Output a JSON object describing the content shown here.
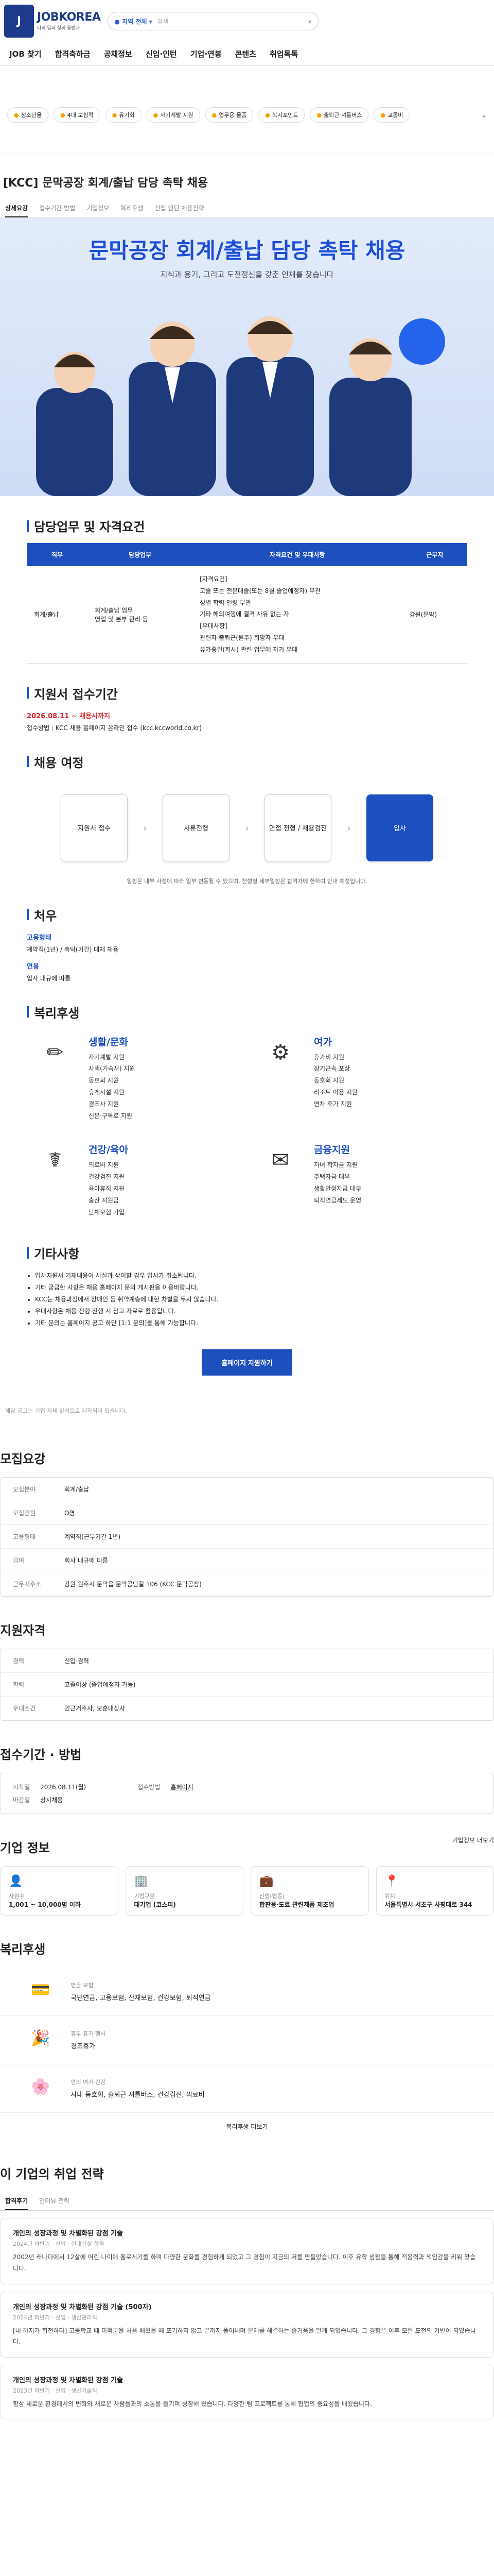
{
  "header": {
    "logo": "JOBKOREA",
    "logo_sub": "나의 일과 삶의 동반자",
    "location": "지역 전체",
    "search_placeholder": "검색"
  },
  "gnb": [
    "JOB 찾기",
    "합격축하금",
    "공채정보",
    "신입·인턴",
    "기업·연봉",
    "콘텐츠",
    "취업톡톡"
  ],
  "quick": [
    "청소년을",
    "4대 보험적",
    "유기회",
    "자기계발 지원",
    "업무용 물품",
    "복지포인트",
    "출퇴근 셔틀버스",
    "교통비"
  ],
  "job": {
    "title": "[KCC] 문막공장 회계/출납 담당 촉탁 채용"
  },
  "tabs": [
    "상세요강",
    "접수기간·방법",
    "기업정보",
    "복리후생",
    "신입 인턴 채용전략"
  ],
  "banner": {
    "title": "문막공장 회계/출납 담당 촉탁 채용",
    "sub": "지식과 용기, 그리고 도전정신을 갖춘 인재를 찾습니다"
  },
  "duty": {
    "title": "담당업무 및 자격요건",
    "headers": [
      "직무",
      "담당업무",
      "자격요건 및 우대사항",
      "근무지"
    ],
    "job": "회계/출납",
    "task": "회계/출납 업무\n영업 및 본부 관리 등",
    "req": "[자격요건]\n고졸 또는 전문대졸(또는 8월 졸업예정자) 무관\n성별 학력 연령 무관\n기타 해외여행에 결격 사유 없는 자\n[우대사항]\n관련자 출퇴근(원주) 희망자 우대\n유가증권(회사) 관련 업무에 자가 우대",
    "place": "강원(문막)"
  },
  "period": {
    "title": "지원서 접수기간",
    "date": "2026.08.11 ~ 채용시까지",
    "note": "접수방법 : KCC 채용 홈페이지 온라인 접수 (kcc.kccworld.co.kr)"
  },
  "steps": {
    "title": "채용 여정",
    "items": [
      "지원서 접수",
      "서류전형",
      "면접 전형 / 채용검진",
      "입사"
    ],
    "note": "일정은 내부 사정에 따라 일부 변동될 수 있으며, 전형별 세부일정은 합격자에 한하여 안내 예정입니다."
  },
  "treat": {
    "title": "처우",
    "label1": "고용형태",
    "val1": "계약직(1년) / 촉탁(기간) 대체 채용",
    "label2": "연봉",
    "val2": "입사 내규에 따름"
  },
  "benefits": {
    "title": "복리후생",
    "items": [
      {
        "name": "생활/문화",
        "icon": "✏",
        "list": [
          "자기계발 지원",
          "사택(기숙사) 지원",
          "동호회 지원",
          "휴게시설 지원",
          "경조사 지원",
          "신문·구독료 지원"
        ]
      },
      {
        "name": "여가",
        "icon": "⚙",
        "list": [
          "휴가비 지원",
          "장기근속 포상",
          "동호회 지원",
          "리조트 이용 지원",
          "연차 휴가 지원"
        ]
      },
      {
        "name": "건강/육아",
        "icon": "☤",
        "list": [
          "의료비 지원",
          "건강검진 지원",
          "육아휴직 지원",
          "출산 지원금",
          "단체보험 가입"
        ]
      },
      {
        "name": "금융지원",
        "icon": "✉",
        "list": [
          "자녀 학자금 지원",
          "주택자금 대부",
          "생활안정자금 대부",
          "퇴직연금제도 운영"
        ]
      }
    ]
  },
  "etc": {
    "title": "기타사항",
    "lines": [
      "입사지원서 기재내용이 사실과 상이할 경우 입사가 취소됩니다.",
      "기타 궁금한 사항은 채용 홈페이지 문의 게시판을 이용바랍니다.",
      "KCC는 채용과정에서 장애인 등 취약계층에 대한 차별을 두지 않습니다.",
      "우대사항은 채용 전형 진행 시 참고 자료로 활용됩니다.",
      "기타 문의는 홈페이지 공고 하단 [1:1 문의]를 통해 가능합니다."
    ],
    "apply": "홈페이지 지원하기"
  },
  "notice": "해당 공고는 기업 자체 양식으로 제작되어 있습니다.",
  "summary": {
    "title": "모집요강",
    "rows": [
      [
        "모집분야",
        "회계/출납"
      ],
      [
        "모집인원",
        "O명"
      ],
      [
        "고용형태",
        "계약직(근무기간 1년)"
      ],
      [
        "급여",
        "회사 내규에 따름"
      ],
      [
        "근무지주소",
        "강원 원주시 문막읍 문막공단길 106 (KCC 문막공장)"
      ]
    ]
  },
  "qual": {
    "title": "지원자격",
    "rows": [
      [
        "경력",
        "신입·경력"
      ],
      [
        "학력",
        "고졸이상 (졸업예정자 가능)"
      ],
      [
        "우대조건",
        "인근거주자, 보훈대상자"
      ]
    ]
  },
  "apply_info": {
    "title": "접수기간 · 방법",
    "start_label": "시작일",
    "start": "2026.08.11(월)",
    "end_label": "마감일",
    "end": "상시채용",
    "method_label": "접수방법",
    "method": "홈페이지"
  },
  "company": {
    "title": "기업 정보",
    "link": "기업정보 더보기",
    "cards": [
      {
        "icon": "👤",
        "label": "사원수",
        "value": "1,001 ~ 10,000명 이하"
      },
      {
        "icon": "🏢",
        "label": "기업구분",
        "value": "대기업 (코스피)"
      },
      {
        "icon": "💼",
        "label": "산업(업종)",
        "value": "합판용·도료 관련제품 제조업"
      },
      {
        "icon": "📍",
        "label": "위치",
        "value": "서울특별시 서초구 사평대로 344"
      }
    ]
  },
  "welfare": {
    "title": "복리후생",
    "rows": [
      {
        "icon": "💳",
        "cat": "연금·보험",
        "text": "국민연금, 고용보험, 산재보험, 건강보험, 퇴직연금"
      },
      {
        "icon": "🎉",
        "cat": "휴무·휴가·행사",
        "text": "경조휴가"
      },
      {
        "icon": "🌸",
        "cat": "편의·여가·건강",
        "text": "사내 동호회, 출퇴근 셔틀버스, 건강검진, 의료비"
      }
    ],
    "more": "복리후생 더보기"
  },
  "strategy": {
    "title": "이 기업의 취업 전략",
    "tabs": [
      "합격후기",
      "인터뷰 전략"
    ],
    "items": [
      {
        "title": "개인의 성장과정 및 차별화된 강점 기술",
        "meta": "2024년 하반기 · 신입 · 현대건설 합격",
        "text": "2002년 캐나다에서 12살에 어린 나이에 홀로서기를 하며 다양한 문화를 경험하게 되었고 그 경험이 지금의 저를 만들었습니다. 이후 유학 생활을 통해 적응력과 책임감을 키워 왔습니다."
      },
      {
        "title": "개인의 성장과정 및 차별화된 강점 기술 (500자)",
        "meta": "2024년 하반기 · 신입 · 생산관리직",
        "text": "[내 하지가 회전하다] 고등학교 때 미적분을 처음 배웠을 때 포기하지 않고 끝까지 풀어내며 문제를 해결하는 즐거움을 알게 되었습니다. 그 경험은 이후 모든 도전의 기반이 되었습니다."
      },
      {
        "title": "개인의 성장과정 및 차별화된 강점 기술",
        "meta": "2023년 하반기 · 신입 · 생산기술직",
        "text": "항상 새로운 환경에서의 변화와 새로운 사람들과의 소통을 즐기며 성장해 왔습니다. 다양한 팀 프로젝트를 통해 협업의 중요성을 배웠습니다."
      }
    ]
  }
}
